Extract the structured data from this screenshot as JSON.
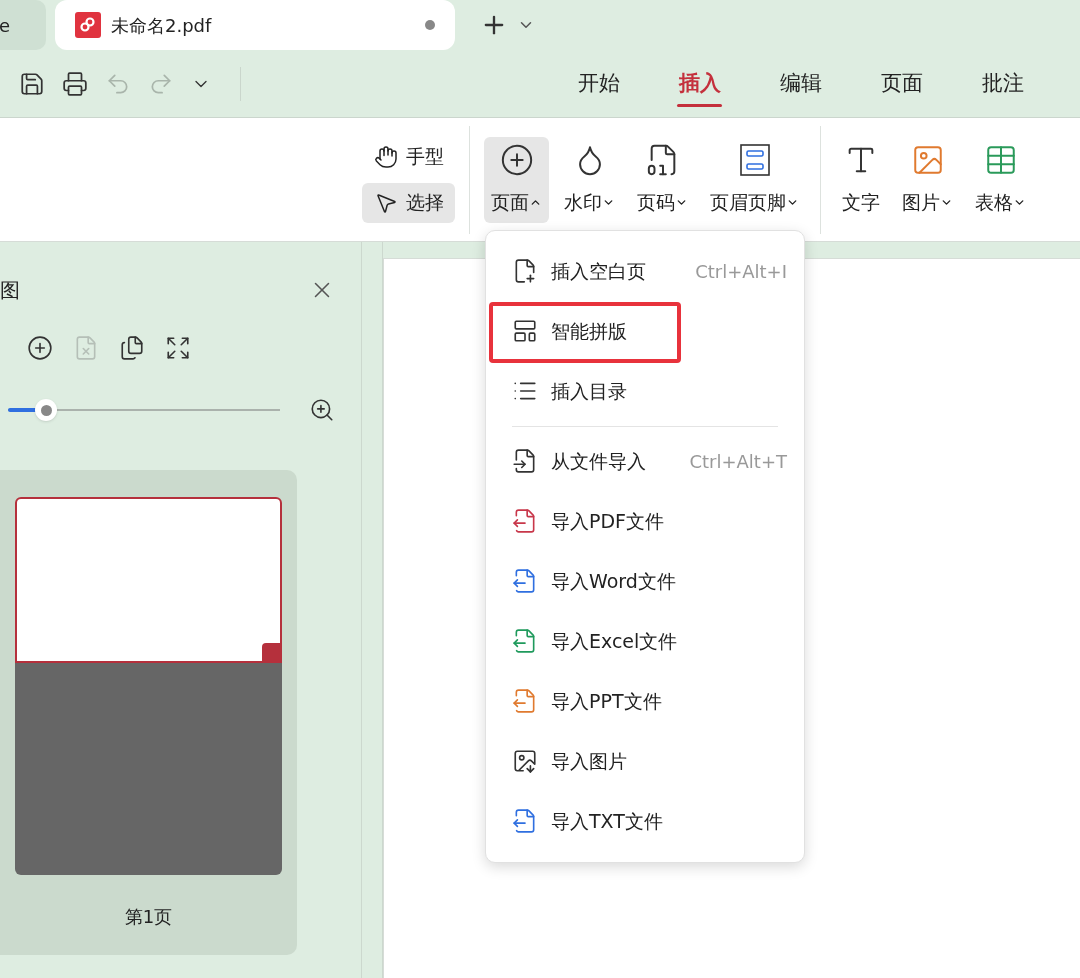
{
  "doc_tabs": [
    {
      "title": "e",
      "selected": false
    },
    {
      "title": "未命名2.pdf",
      "selected": true,
      "unsaved": true
    }
  ],
  "quick_access": [
    {
      "kind": "save",
      "disabled": false
    },
    {
      "kind": "print",
      "disabled": false
    },
    {
      "kind": "undo",
      "disabled": true
    },
    {
      "kind": "redo",
      "disabled": true
    },
    {
      "kind": "more",
      "disabled": false
    }
  ],
  "menu_tabs": [
    {
      "label": "开始",
      "selected": false
    },
    {
      "label": "插入",
      "selected": true
    },
    {
      "label": "编辑",
      "selected": false
    },
    {
      "label": "页面",
      "selected": false
    },
    {
      "label": "批注",
      "selected": false
    }
  ],
  "tools": [
    {
      "kind": "hand",
      "label": "手型",
      "selected": false
    },
    {
      "kind": "select",
      "label": "选择",
      "selected": true
    }
  ],
  "ribbon_groups": [
    [
      {
        "kind": "page",
        "label": "页面",
        "dropdown": true,
        "expanded": true
      },
      {
        "kind": "watermark",
        "label": "水印",
        "dropdown": true,
        "expanded": false
      },
      {
        "kind": "page-number",
        "label": "页码",
        "dropdown": true,
        "expanded": false
      },
      {
        "kind": "header-footer",
        "label": "页眉页脚",
        "dropdown": true,
        "expanded": false
      }
    ],
    [
      {
        "kind": "text",
        "label": "文字",
        "dropdown": false,
        "expanded": false
      },
      {
        "kind": "image",
        "label": "图片",
        "dropdown": true,
        "expanded": false
      },
      {
        "kind": "table",
        "label": "表格",
        "dropdown": true,
        "expanded": false
      }
    ]
  ],
  "side_panel": {
    "title": "图",
    "tools": [
      {
        "kind": "add",
        "disabled": false
      },
      {
        "kind": "delete",
        "disabled": true
      },
      {
        "kind": "replace",
        "disabled": false
      },
      {
        "kind": "extract",
        "disabled": false
      }
    ],
    "zoom": {
      "level": 0.14
    },
    "thumbnails": [
      {
        "label": "第1页",
        "selected": true
      }
    ]
  },
  "dropdown": {
    "groups": [
      [
        {
          "kind": "blank-page",
          "label": "插入空白页",
          "shortcut": "Ctrl+Alt+I",
          "highlighted": false
        },
        {
          "kind": "smart-layout",
          "label": "智能拼版",
          "highlighted": true
        },
        {
          "kind": "toc",
          "label": "插入目录",
          "highlighted": false
        }
      ],
      [
        {
          "kind": "from-file",
          "label": "从文件导入",
          "shortcut": "Ctrl+Alt+T",
          "highlighted": false
        },
        {
          "kind": "pdf",
          "label": "导入PDF文件",
          "highlighted": false
        },
        {
          "kind": "word",
          "label": "导入Word文件",
          "highlighted": false
        },
        {
          "kind": "excel",
          "label": "导入Excel文件",
          "highlighted": false
        },
        {
          "kind": "ppt",
          "label": "导入PPT文件",
          "highlighted": false
        },
        {
          "kind": "image",
          "label": "导入图片",
          "highlighted": false
        },
        {
          "kind": "txt",
          "label": "导入TXT文件",
          "highlighted": false
        }
      ]
    ]
  }
}
